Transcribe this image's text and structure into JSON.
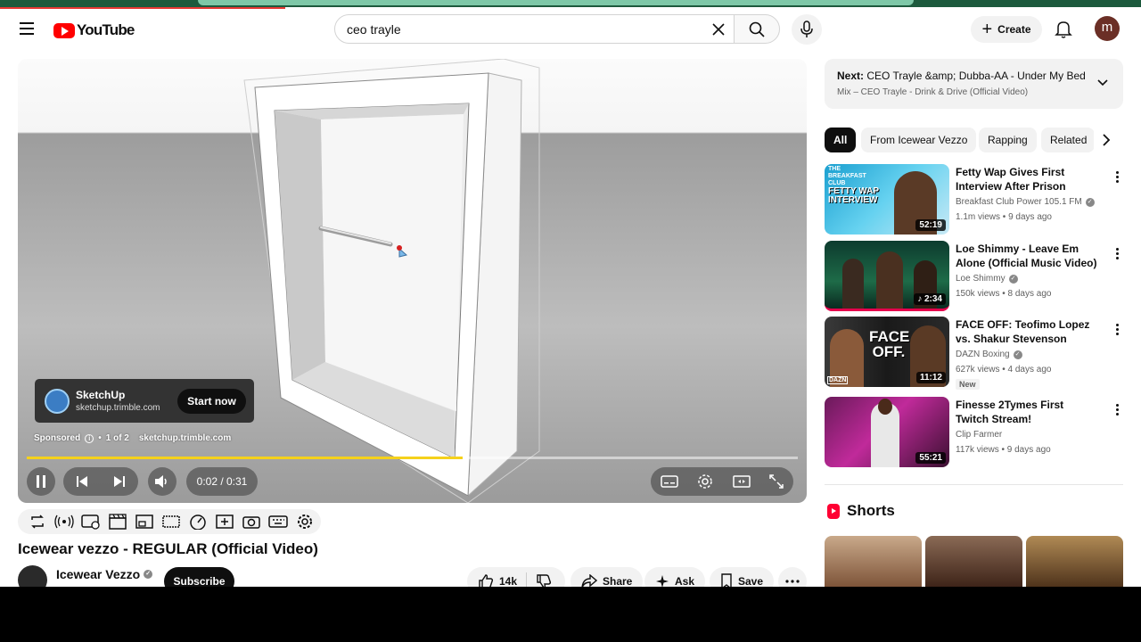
{
  "header": {
    "logo_text": "YouTube",
    "search_value": "ceo trayle",
    "create_label": "Create",
    "avatar_initial": "m"
  },
  "player": {
    "ad": {
      "title": "SketchUp",
      "url": "sketchup.trimble.com",
      "cta": "Start now",
      "sponsored_label": "Sponsored",
      "count": "1 of 2",
      "separator": "•",
      "sponsored_url": "sketchup.trimble.com"
    },
    "progress_fraction": 0.565,
    "time": "0:02 / 0:31"
  },
  "video": {
    "title": "Icewear vezzo - REGULAR (Official Video)",
    "channel": "Icewear Vezzo",
    "subscribe_label": "Subscribe",
    "likes": "14k",
    "share_label": "Share",
    "ask_label": "Ask",
    "save_label": "Save"
  },
  "sidebar": {
    "next": {
      "prefix": "Next:",
      "title": "CEO Trayle &amp; Dubba-AA - Under My Bed (...",
      "subtitle": "Mix – CEO Trayle - Drink & Drive (Official Video)"
    },
    "chips": [
      "All",
      "From Icewear Vezzo",
      "Rapping",
      "Related"
    ],
    "recommendations": [
      {
        "title": "Fetty Wap Gives First Interview After Prison Release",
        "channel": "Breakfast Club Power 105.1 FM",
        "meta": "1.1m views • 9 days ago",
        "duration": "52:19",
        "thumb_text": "FETTY WAP INTERVIEW",
        "thumb_logo": "THE BREAKFAST CLUB",
        "badge": ""
      },
      {
        "title": "Loe Shimmy - Leave Em Alone (Official Music Video)",
        "channel": "Loe Shimmy",
        "meta": "150k views • 8 days ago",
        "duration": "♪ 2:34",
        "thumb_text": "",
        "thumb_logo": "",
        "badge": ""
      },
      {
        "title": "FACE OFF: Teofimo Lopez vs. Shakur Stevenson",
        "channel": "DAZN Boxing",
        "meta": "627k views • 4 days ago",
        "duration": "11:12",
        "thumb_text": "FACE OFF.",
        "thumb_logo": "DAZN",
        "badge": "New"
      },
      {
        "title": "Finesse 2Tymes First Twitch Stream!",
        "channel": "Clip Farmer",
        "meta": "117k views • 9 days ago",
        "duration": "55:21",
        "thumb_text": "",
        "thumb_logo": "",
        "badge": ""
      }
    ],
    "shorts_label": "Shorts"
  }
}
